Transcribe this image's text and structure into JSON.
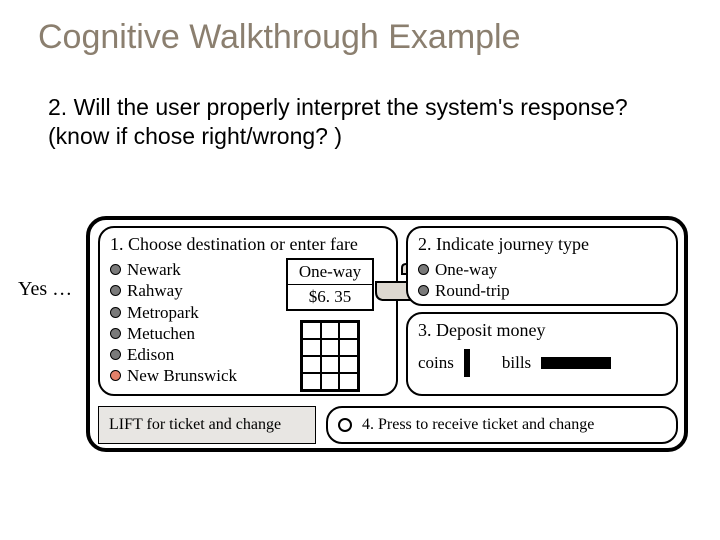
{
  "title": "Cognitive Walkthrough Example",
  "question": "2. Will the user properly interpret the system's response? (know if chose right/wrong? )",
  "yes": "Yes …",
  "panel1": {
    "title": "1. Choose destination or enter fare",
    "destinations": [
      "Newark",
      "Rahway",
      "Metropark",
      "Metuchen",
      "Edison",
      "New Brunswick"
    ],
    "selected": "One-way",
    "fare": "$6. 35"
  },
  "panel2": {
    "title": "2. Indicate journey type",
    "options": [
      "One-way",
      "Round-trip"
    ]
  },
  "panel3": {
    "title": "3. Deposit money",
    "coins": "coins",
    "bills": "bills"
  },
  "panel4": {
    "text": "4. Press to receive ticket and change"
  },
  "lift": "LIFT for ticket and change"
}
